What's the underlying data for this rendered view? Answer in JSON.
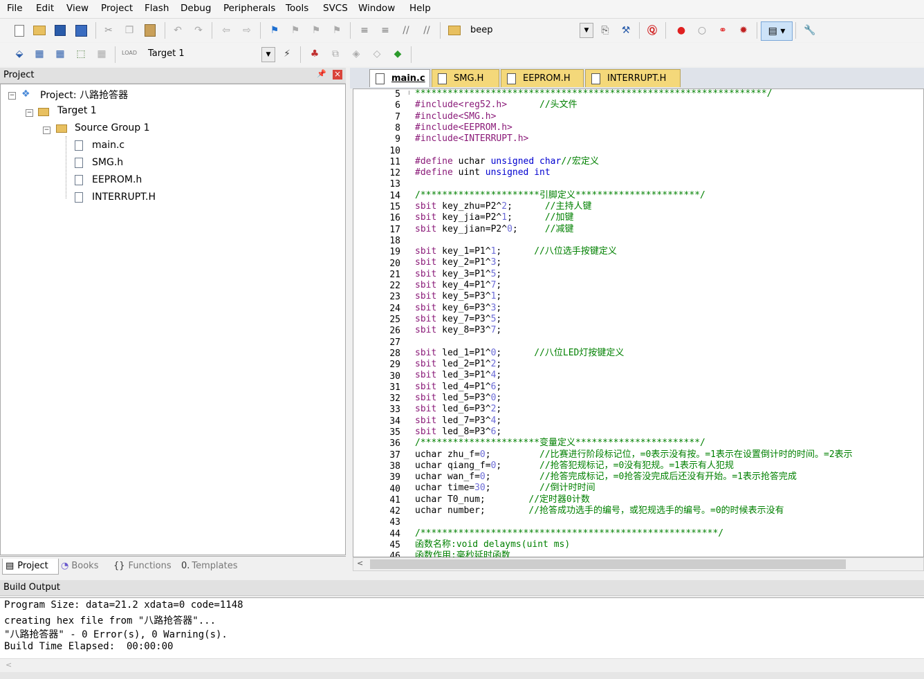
{
  "menu": {
    "items": [
      "File",
      "Edit",
      "View",
      "Project",
      "Flash",
      "Debug",
      "Peripherals",
      "Tools",
      "SVCS",
      "Window",
      "Help"
    ]
  },
  "toolbar": {
    "target_combo": "beep",
    "build_target": "Target 1",
    "load_label": "LOAD"
  },
  "project_panel": {
    "title": "Project",
    "pin_glyph": "📌",
    "close_glyph": "×",
    "tree": {
      "project": "Project: 八路抢答器",
      "target": "Target 1",
      "group": "Source Group 1",
      "files": [
        "main.c",
        "SMG.h",
        "EEPROM.h",
        "INTERRUPT.H"
      ]
    },
    "tabs": [
      "Project",
      "Books",
      "Functions",
      "Templates"
    ],
    "tab_icons": [
      "▤",
      "◔",
      "{}",
      "0."
    ]
  },
  "editor": {
    "tabs": [
      "main.c",
      "SMG.H",
      "EEPROM.H",
      "INTERRUPT.H"
    ],
    "active_tab": "main.c",
    "line_numbers": [
      "5",
      "6",
      "7",
      "8",
      "9",
      "10",
      "11",
      "12",
      "13",
      "14",
      "15",
      "16",
      "17",
      "18",
      "19",
      "20",
      "21",
      "22",
      "23",
      "24",
      "25",
      "26",
      "27",
      "28",
      "29",
      "30",
      "31",
      "32",
      "33",
      "34",
      "35",
      "36",
      "37",
      "38",
      "39",
      "40",
      "41",
      "42",
      "43",
      "44",
      "45",
      "46"
    ]
  },
  "build_output": {
    "title": "Build Output",
    "lines": [
      "Program Size: data=21.2 xdata=0 code=1148",
      "creating hex file from \"八路抢答器\"...",
      "\"八路抢答器\" - 0 Error(s), 0 Warning(s).",
      "Build Time Elapsed:  00:00:00"
    ]
  },
  "colors": {
    "preprocessor": "#8a1a78",
    "keyword": "#0000d0",
    "comment": "#008000",
    "tab_inactive": "#f4d87a"
  }
}
